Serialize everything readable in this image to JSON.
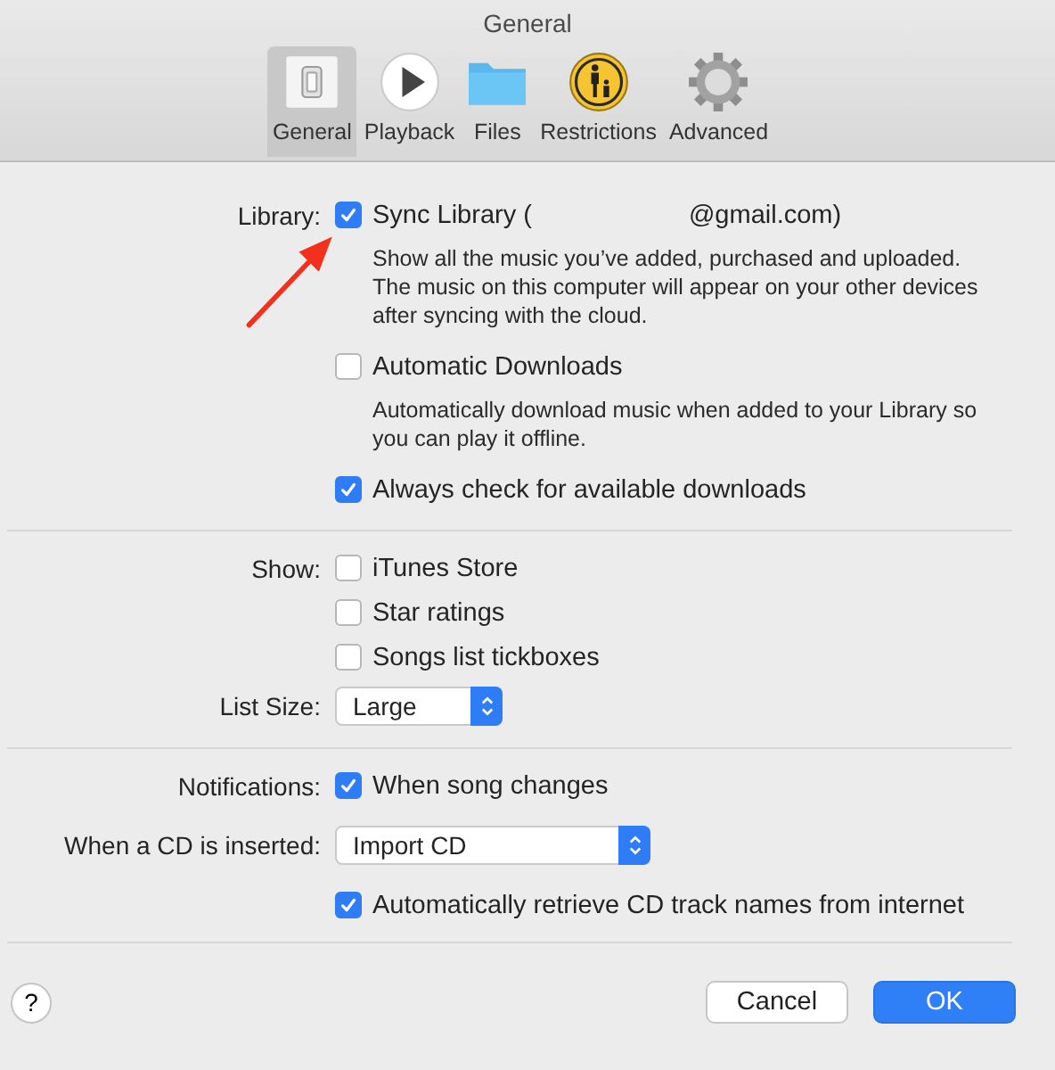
{
  "window": {
    "title": "General"
  },
  "tabs": [
    {
      "label": "General",
      "selected": true
    },
    {
      "label": "Playback",
      "selected": false
    },
    {
      "label": "Files",
      "selected": false
    },
    {
      "label": "Restrictions",
      "selected": false
    },
    {
      "label": "Advanced",
      "selected": false
    }
  ],
  "sections": [
    {
      "rows": [
        {
          "kind": "checkbox",
          "label": "Library:",
          "text": "Sync Library (",
          "suffix": "@gmail.com)",
          "checked": true
        },
        {
          "kind": "note",
          "text": "Show all the music you’ve added, purchased and uploaded. The music on this computer will appear on your other devices after syncing with the cloud."
        },
        {
          "kind": "checkbox",
          "text": "Automatic Downloads",
          "checked": false
        },
        {
          "kind": "note",
          "text": "Automatically download music when added to your Library so you can play it offline."
        },
        {
          "kind": "checkbox",
          "text": "Always check for available downloads",
          "checked": true
        }
      ]
    },
    {
      "rows": [
        {
          "kind": "checkbox",
          "label": "Show:",
          "text": "iTunes Store",
          "checked": false
        },
        {
          "kind": "checkbox",
          "text": "Star ratings",
          "checked": false
        },
        {
          "kind": "checkbox",
          "text": "Songs list tickboxes",
          "checked": false
        },
        {
          "kind": "select",
          "label": "List Size:",
          "value": "Large"
        }
      ]
    },
    {
      "rows": [
        {
          "kind": "checkbox",
          "label": "Notifications:",
          "text": "When song changes",
          "checked": true
        },
        {
          "kind": "select",
          "label": "When a CD is inserted:",
          "value": "Import CD"
        },
        {
          "kind": "checkbox",
          "text": "Automatically retrieve CD track names from internet",
          "checked": true
        }
      ]
    }
  ],
  "footer": {
    "help": "?",
    "buttons": [
      {
        "label": "Cancel",
        "default": false
      },
      {
        "label": "OK",
        "default": true
      }
    ]
  }
}
